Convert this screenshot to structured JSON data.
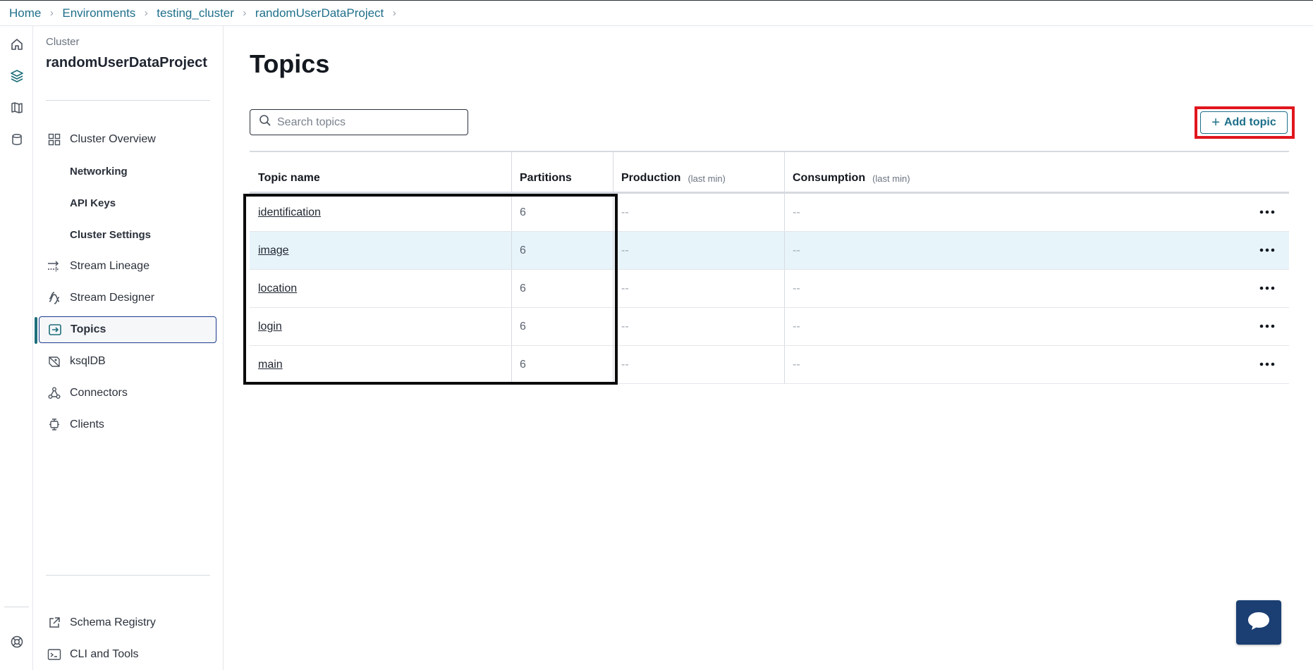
{
  "breadcrumb": {
    "items": [
      "Home",
      "Environments",
      "testing_cluster",
      "randomUserDataProject"
    ]
  },
  "nav": {
    "caption": "Cluster",
    "cluster_name": "randomUserDataProject",
    "items": [
      {
        "label": "Cluster Overview",
        "icon": "grid-icon"
      },
      {
        "label": "Networking"
      },
      {
        "label": "API Keys"
      },
      {
        "label": "Cluster Settings"
      },
      {
        "label": "Stream Lineage",
        "icon": "lineage-icon"
      },
      {
        "label": "Stream Designer",
        "icon": "designer-icon"
      },
      {
        "label": "Topics",
        "icon": "topics-icon",
        "active": true
      },
      {
        "label": "ksqlDB",
        "icon": "ksqldb-icon"
      },
      {
        "label": "Connectors",
        "icon": "connectors-icon"
      },
      {
        "label": "Clients",
        "icon": "clients-icon"
      }
    ],
    "bottom_items": [
      {
        "label": "Schema Registry",
        "icon": "external-link-icon"
      },
      {
        "label": "CLI and Tools",
        "icon": "terminal-icon"
      }
    ]
  },
  "page": {
    "title": "Topics",
    "search_placeholder": "Search topics",
    "add_button": "Add topic"
  },
  "table": {
    "columns": [
      {
        "label": "Topic name",
        "note": ""
      },
      {
        "label": "Partitions",
        "note": ""
      },
      {
        "label": "Production",
        "note": "(last min)"
      },
      {
        "label": "Consumption",
        "note": "(last min)"
      }
    ],
    "rows": [
      {
        "name": "identification",
        "partitions": "6",
        "production": "--",
        "consumption": "--"
      },
      {
        "name": "image",
        "partitions": "6",
        "production": "--",
        "consumption": "--",
        "highlighted": true
      },
      {
        "name": "location",
        "partitions": "6",
        "production": "--",
        "consumption": "--"
      },
      {
        "name": "login",
        "partitions": "6",
        "production": "--",
        "consumption": "--"
      },
      {
        "name": "main",
        "partitions": "6",
        "production": "--",
        "consumption": "--"
      }
    ]
  },
  "colors": {
    "accent": "#1d6f8a",
    "highlight_row": "#e7f4fa",
    "annotation_red": "#e0161e",
    "chat_button": "#1b3f73"
  }
}
